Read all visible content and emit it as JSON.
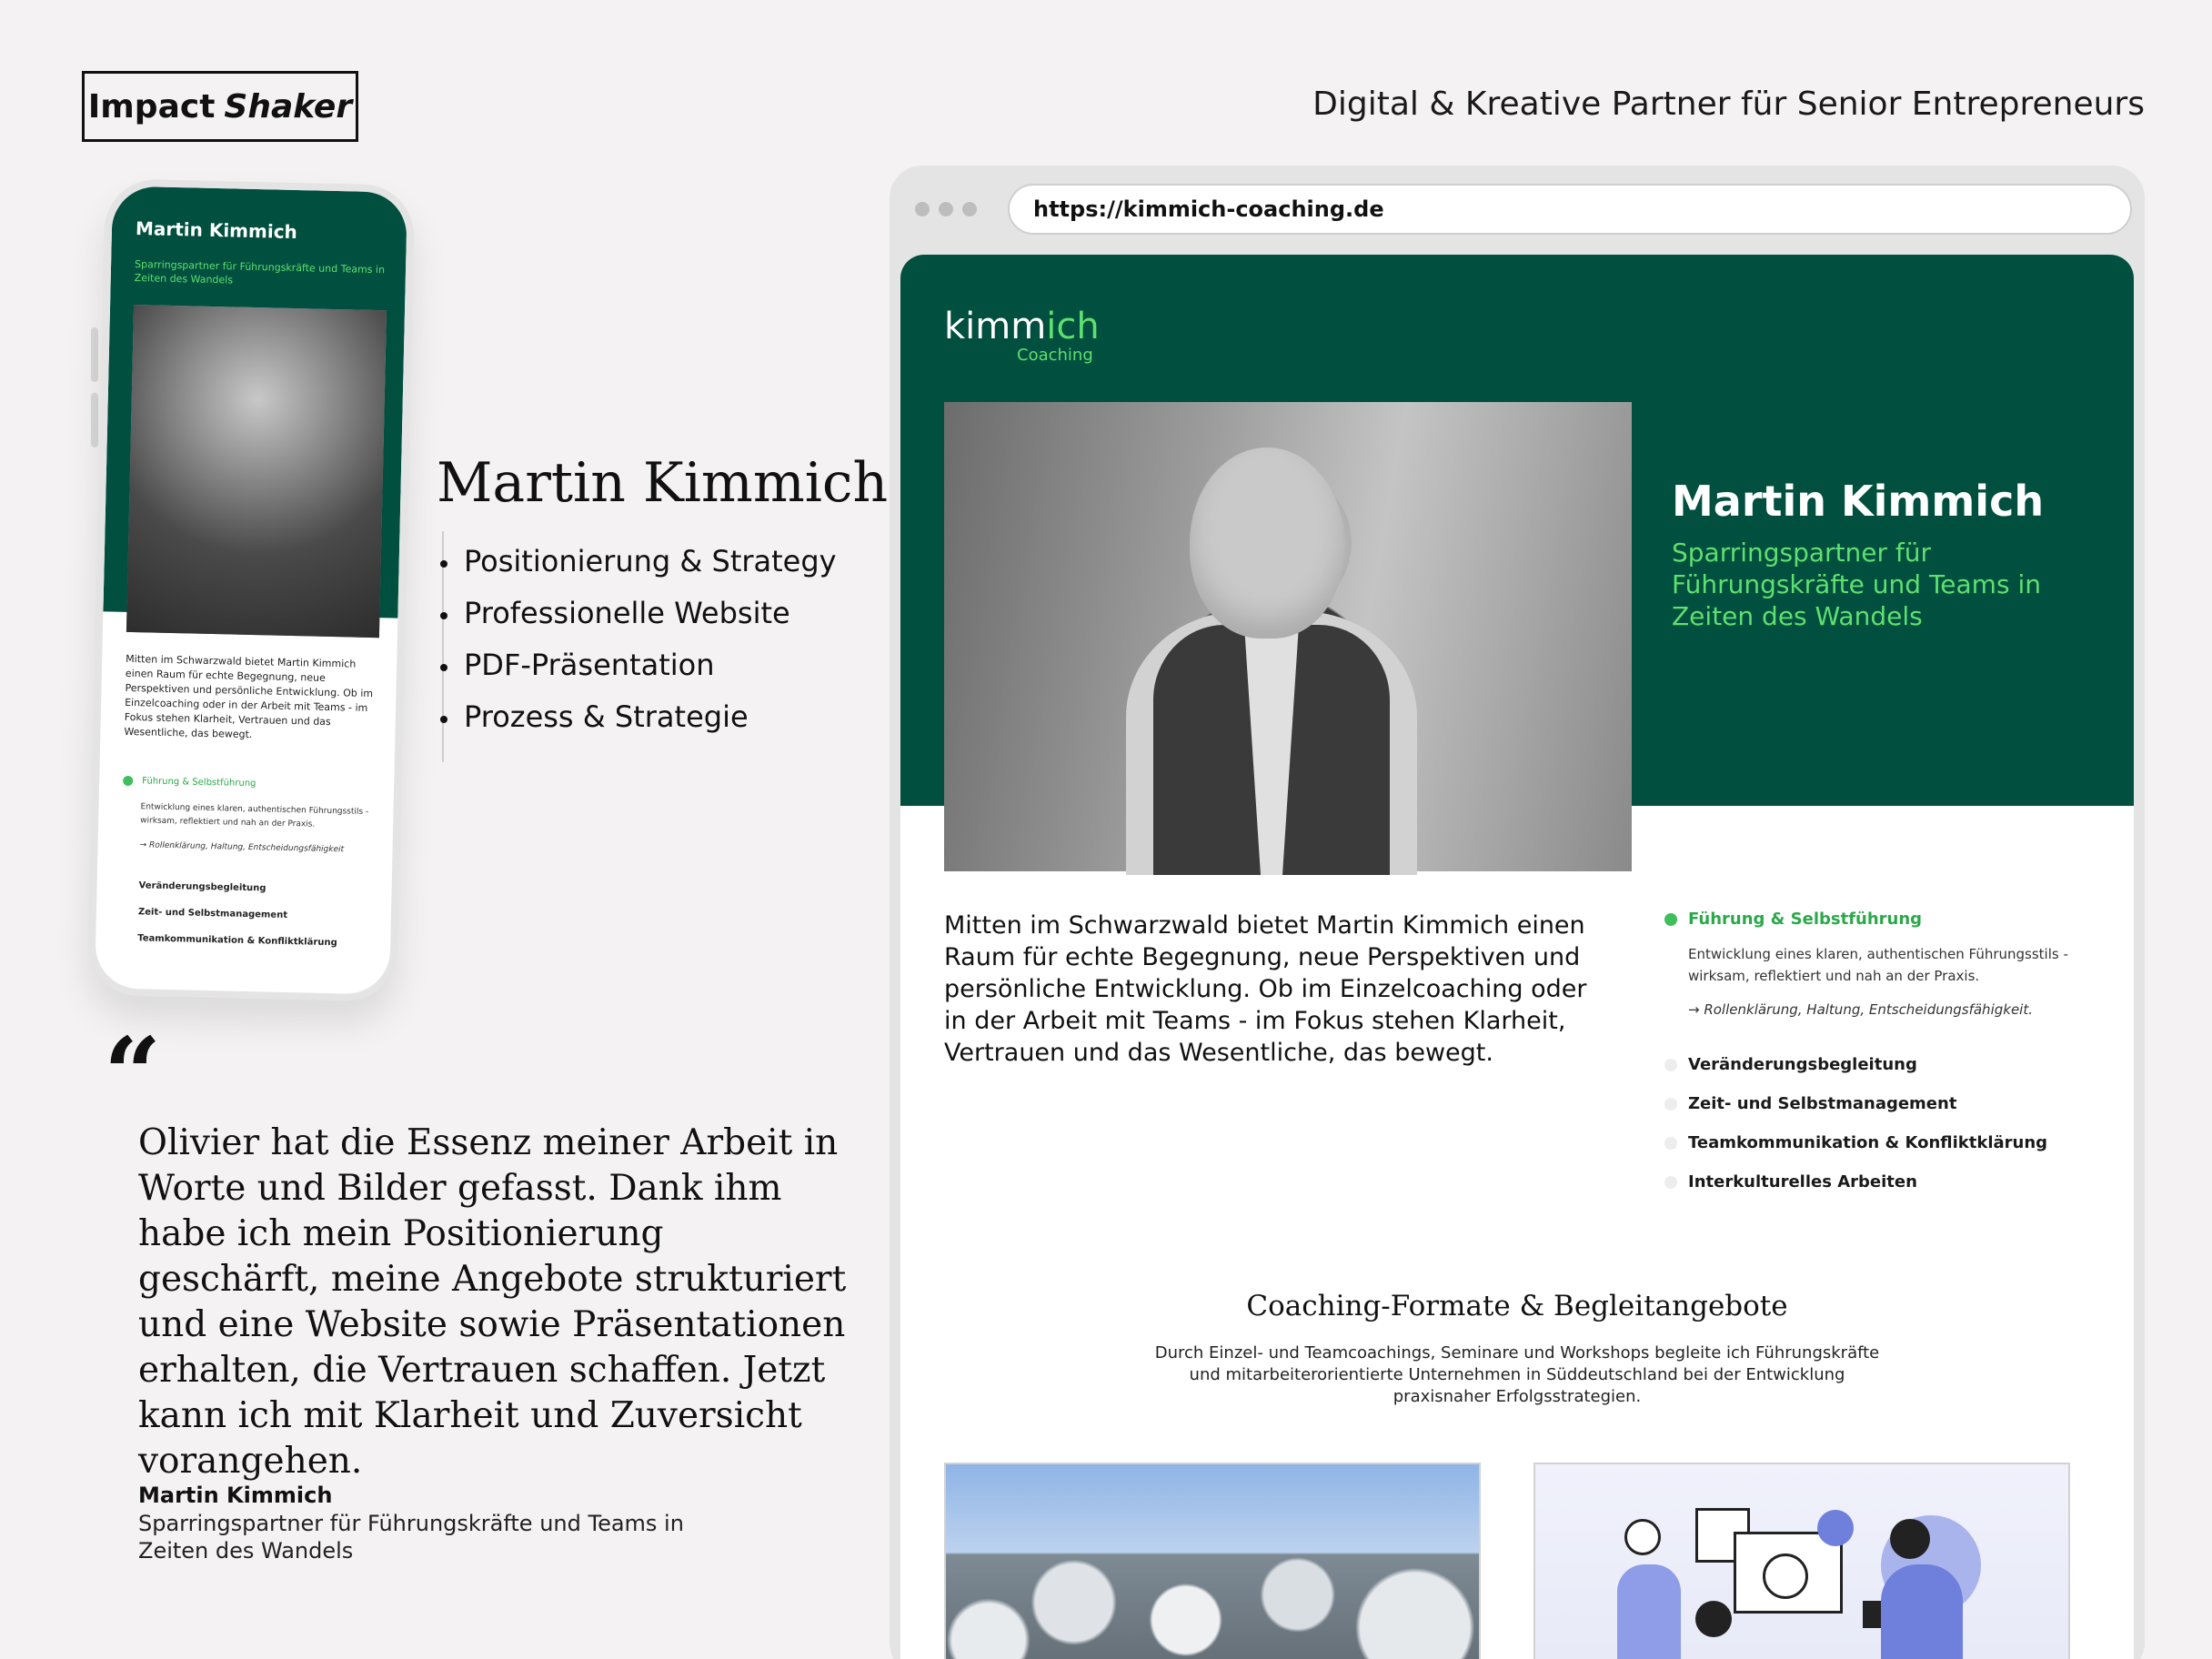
{
  "brand": {
    "name_part1": "Impact",
    "name_part2": "Shaker"
  },
  "tagline": "Digital & Kreative Partner für Senior Entrepreneurs",
  "phone": {
    "name": "Martin Kimmich",
    "subtitle": "Sparringspartner für Führungskräfte und Teams in Zeiten des Wandels",
    "intro": "Mitten im Schwarzwald bietet Martin Kimmich einen Raum für echte Begegnung, neue Perspektiven und persönliche Entwicklung. Ob im Einzelcoaching oder in der Arbeit mit Teams - im Fokus stehen Klarheit, Vertrauen und das Wesentliche, das bewegt.",
    "active_service": "Führung & Selbstführung",
    "active_desc": "Entwicklung eines klaren, authentischen Führungsstils - wirksam, reflektiert und nah an der Praxis.",
    "active_arrow": "→ Rollenklärung, Haltung, Entscheidungsfähigkeit",
    "services": [
      "Veränderungsbegleitung",
      "Zeit- und Selbstmanagement",
      "Teamkommunikation & Konfliktklärung"
    ]
  },
  "project": {
    "name": "Martin Kimmich",
    "deliverables": [
      "Positionierung & Strategy",
      "Professionelle Website",
      "PDF-Präsentation",
      "Prozess & Strategie"
    ]
  },
  "testimonial": {
    "quote_mark": "“",
    "quote": "Olivier hat die Essenz meiner Arbeit in Worte und Bilder gefasst. Dank ihm habe ich mein Positionierung geschärft, meine Angebote strukturiert und eine Website sowie Präsentationen erhalten, die Vertrauen schaffen. Jetzt kann ich mit Klarheit und Zuversicht vorangehen.",
    "author": "Martin Kimmich",
    "role": "Sparringspartner für Führungskräfte und Teams in Zeiten des Wandels"
  },
  "browser": {
    "url": "https://kimmich-coaching.de",
    "logo_main": "kimm",
    "logo_accent": "ich",
    "logo_sub": "Coaching",
    "hero_name": "Martin Kimmich",
    "hero_sub": "Sparringspartner für Führungskräfte und Teams in Zeiten des Wandels",
    "intro": "Mitten im Schwarzwald bietet Martin Kimmich einen Raum für echte Begegnung, neue Perspektiven und persönliche Entwicklung. Ob im Einzelcoaching oder in der Arbeit mit Teams - im Fokus stehen Klarheit, Vertrauen und das Wesentliche, das bewegt.",
    "active_service": "Führung & Selbstführung",
    "active_desc": "Entwicklung eines klaren, authentischen Führungsstils - wirksam, reflektiert und nah an der Praxis.",
    "active_arrow": "→ Rollenklärung, Haltung, Entscheidungsfähigkeit.",
    "services": [
      "Veränderungsbegleitung",
      "Zeit- und Selbstmanagement",
      "Teamkommunikation & Konfliktklärung",
      "Interkulturelles Arbeiten"
    ],
    "formats_title": "Coaching-Formate & Begleitangebote",
    "formats_text": "Durch Einzel- und Teamcoachings, Seminare und Workshops begleite ich Führungskräfte und mitarbeiterorientierte Unternehmen in Süddeutschland bei der Entwicklung praxisnaher Erfolgsstrategien."
  },
  "colors": {
    "brand_green": "#004f3f",
    "accent_green": "#5ee06e",
    "active_dot": "#3fbf5b"
  }
}
